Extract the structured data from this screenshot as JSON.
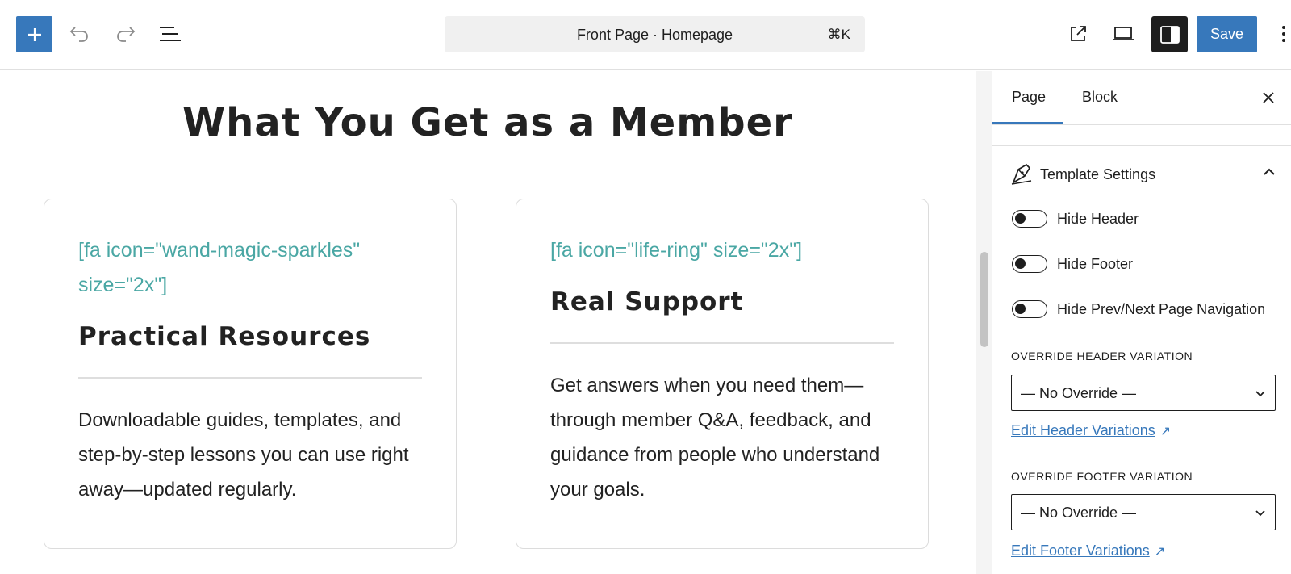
{
  "topbar": {
    "add_icon": "plus-icon",
    "undo_icon": "undo-icon",
    "redo_icon": "redo-icon",
    "list_view_icon": "list-view-icon",
    "command": {
      "title": "Front Page · Homepage",
      "shortcut": "⌘K"
    },
    "view_icon": "external-link-icon",
    "device_icon": "desktop-icon",
    "sidebar_icon": "sidebar-toggle-icon",
    "save_label": "Save",
    "more_icon": "more-vertical-icon",
    "accent_color": "#3778bb"
  },
  "canvas": {
    "heading": "What You Get as a Member",
    "cards": [
      {
        "shortcode_line1": "[fa icon=\"wand-magic-sparkles\"",
        "shortcode_line2": "size=\"2x\"]",
        "title": "Practical Resources",
        "body": "Downloadable guides, templates, and step-by-step lessons you can use right away—updated regularly."
      },
      {
        "shortcode_line1": "[fa icon=\"life-ring\" size=\"2x\"]",
        "shortcode_line2": "",
        "title": "Real Support",
        "body": "Get answers when you need them—through member Q&A, feedback, and guidance from people who understand your goals."
      }
    ],
    "shortcode_color": "#4aa7a4"
  },
  "sidebar": {
    "tabs": [
      {
        "label": "Page",
        "active": true
      },
      {
        "label": "Block",
        "active": false
      }
    ],
    "panel": {
      "title": "Template Settings",
      "toggles": [
        {
          "label": "Hide Header",
          "checked": false
        },
        {
          "label": "Hide Footer",
          "checked": false
        },
        {
          "label": "Hide Prev/Next Page Navigation",
          "checked": false
        }
      ],
      "header_override": {
        "label": "OVERRIDE HEADER VARIATION",
        "value": "— No Override —",
        "link": "Edit Header Variations"
      },
      "footer_override": {
        "label": "OVERRIDE FOOTER VARIATION",
        "value": "— No Override —",
        "link": "Edit Footer Variations"
      }
    }
  }
}
